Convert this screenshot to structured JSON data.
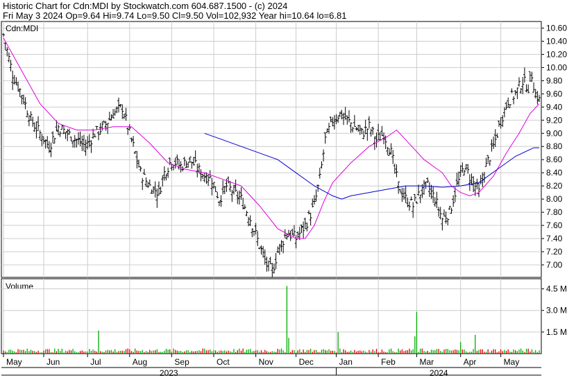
{
  "header": {
    "line1": "Historic Chart for Cdn:MDI by Stockwatch.com 604.687.1500 - (c) 2024",
    "line2": "Fri May  3 2024  Op=9.64  Hi=9.74  Lo=9.50  Cl=9.50  Vol=102,932  Year hi=10.64  lo=6.81"
  },
  "colors": {
    "bar": "#000000",
    "ma_short": "#dd00dd",
    "ma_long": "#0000cc",
    "vol_up": "#00aa00",
    "vol_down": "#dd0000",
    "grid": "#cccccc"
  },
  "chart_data": [
    {
      "type": "bar",
      "subtype": "ohlc",
      "title": "Cdn:MDI",
      "ylim": [
        6.81,
        10.7
      ],
      "yticks": [
        "10.60",
        "10.40",
        "10.20",
        "10.00",
        "9.80",
        "9.60",
        "9.40",
        "9.20",
        "9.00",
        "8.80",
        "8.60",
        "8.40",
        "8.20",
        "8.00",
        "7.80",
        "7.60",
        "7.40",
        "7.20",
        "7.00"
      ],
      "grid": true,
      "x_months": [
        "May",
        "Jun",
        "Jul",
        "Aug",
        "Sep",
        "Oct",
        "Nov",
        "Dec",
        "Jan",
        "Feb",
        "Mar",
        "Apr",
        "May"
      ],
      "x_years": [
        "2023",
        "2024"
      ],
      "close_series": [
        {
          "i": 0,
          "c": 10.5
        },
        {
          "i": 5,
          "c": 9.9
        },
        {
          "i": 10,
          "c": 9.6
        },
        {
          "i": 15,
          "c": 9.2
        },
        {
          "i": 20,
          "c": 9.0
        },
        {
          "i": 25,
          "c": 8.8
        },
        {
          "i": 30,
          "c": 9.1
        },
        {
          "i": 35,
          "c": 9.0
        },
        {
          "i": 40,
          "c": 8.9
        },
        {
          "i": 45,
          "c": 8.8
        },
        {
          "i": 50,
          "c": 9.0
        },
        {
          "i": 55,
          "c": 9.1
        },
        {
          "i": 60,
          "c": 9.3
        },
        {
          "i": 65,
          "c": 9.4
        },
        {
          "i": 70,
          "c": 8.9
        },
        {
          "i": 75,
          "c": 8.4
        },
        {
          "i": 80,
          "c": 8.2
        },
        {
          "i": 85,
          "c": 8.1
        },
        {
          "i": 88,
          "c": 8.4
        },
        {
          "i": 92,
          "c": 8.6
        },
        {
          "i": 97,
          "c": 8.5
        },
        {
          "i": 102,
          "c": 8.6
        },
        {
          "i": 108,
          "c": 8.4
        },
        {
          "i": 114,
          "c": 8.3
        },
        {
          "i": 118,
          "c": 8.0
        },
        {
          "i": 122,
          "c": 8.2
        },
        {
          "i": 126,
          "c": 8.1
        },
        {
          "i": 130,
          "c": 8.0
        },
        {
          "i": 135,
          "c": 7.7
        },
        {
          "i": 140,
          "c": 7.3
        },
        {
          "i": 144,
          "c": 7.0
        },
        {
          "i": 147,
          "c": 6.9
        },
        {
          "i": 150,
          "c": 7.2
        },
        {
          "i": 155,
          "c": 7.5
        },
        {
          "i": 160,
          "c": 7.4
        },
        {
          "i": 165,
          "c": 7.6
        },
        {
          "i": 170,
          "c": 7.9
        },
        {
          "i": 173,
          "c": 8.3
        },
        {
          "i": 176,
          "c": 8.9
        },
        {
          "i": 180,
          "c": 9.2
        },
        {
          "i": 184,
          "c": 9.3
        },
        {
          "i": 188,
          "c": 9.2
        },
        {
          "i": 192,
          "c": 9.1
        },
        {
          "i": 196,
          "c": 9.0
        },
        {
          "i": 200,
          "c": 9.1
        },
        {
          "i": 204,
          "c": 8.9
        },
        {
          "i": 208,
          "c": 9.0
        },
        {
          "i": 212,
          "c": 8.7
        },
        {
          "i": 216,
          "c": 8.2
        },
        {
          "i": 220,
          "c": 8.0
        },
        {
          "i": 224,
          "c": 7.9
        },
        {
          "i": 228,
          "c": 8.1
        },
        {
          "i": 232,
          "c": 8.2
        },
        {
          "i": 236,
          "c": 8.0
        },
        {
          "i": 240,
          "c": 7.7
        },
        {
          "i": 244,
          "c": 7.8
        },
        {
          "i": 248,
          "c": 8.2
        },
        {
          "i": 252,
          "c": 8.5
        },
        {
          "i": 256,
          "c": 8.3
        },
        {
          "i": 260,
          "c": 8.1
        },
        {
          "i": 264,
          "c": 8.5
        },
        {
          "i": 268,
          "c": 8.8
        },
        {
          "i": 272,
          "c": 9.2
        },
        {
          "i": 276,
          "c": 9.5
        },
        {
          "i": 280,
          "c": 9.6
        },
        {
          "i": 284,
          "c": 9.8
        },
        {
          "i": 287,
          "c": 9.7
        },
        {
          "i": 289,
          "c": 9.9
        },
        {
          "i": 291,
          "c": 9.6
        },
        {
          "i": 293,
          "c": 9.5
        }
      ],
      "ma_short": [
        {
          "i": 0,
          "v": 10.45
        },
        {
          "i": 10,
          "v": 9.95
        },
        {
          "i": 20,
          "v": 9.45
        },
        {
          "i": 30,
          "v": 9.15
        },
        {
          "i": 40,
          "v": 9.05
        },
        {
          "i": 50,
          "v": 9.05
        },
        {
          "i": 60,
          "v": 9.1
        },
        {
          "i": 70,
          "v": 9.1
        },
        {
          "i": 80,
          "v": 8.85
        },
        {
          "i": 90,
          "v": 8.55
        },
        {
          "i": 100,
          "v": 8.45
        },
        {
          "i": 110,
          "v": 8.4
        },
        {
          "i": 120,
          "v": 8.3
        },
        {
          "i": 130,
          "v": 8.2
        },
        {
          "i": 140,
          "v": 7.9
        },
        {
          "i": 150,
          "v": 7.55
        },
        {
          "i": 160,
          "v": 7.4
        },
        {
          "i": 165,
          "v": 7.4
        },
        {
          "i": 170,
          "v": 7.6
        },
        {
          "i": 175,
          "v": 7.95
        },
        {
          "i": 180,
          "v": 8.25
        },
        {
          "i": 190,
          "v": 8.55
        },
        {
          "i": 200,
          "v": 8.8
        },
        {
          "i": 210,
          "v": 8.95
        },
        {
          "i": 215,
          "v": 9.05
        },
        {
          "i": 220,
          "v": 8.9
        },
        {
          "i": 230,
          "v": 8.6
        },
        {
          "i": 240,
          "v": 8.4
        },
        {
          "i": 245,
          "v": 8.2
        },
        {
          "i": 250,
          "v": 8.1
        },
        {
          "i": 255,
          "v": 8.05
        },
        {
          "i": 260,
          "v": 8.1
        },
        {
          "i": 268,
          "v": 8.35
        },
        {
          "i": 275,
          "v": 8.7
        },
        {
          "i": 282,
          "v": 9.0
        },
        {
          "i": 288,
          "v": 9.3
        },
        {
          "i": 293,
          "v": 9.45
        }
      ],
      "ma_long": [
        {
          "i": 110,
          "v": 9.0
        },
        {
          "i": 120,
          "v": 8.9
        },
        {
          "i": 130,
          "v": 8.8
        },
        {
          "i": 140,
          "v": 8.7
        },
        {
          "i": 150,
          "v": 8.6
        },
        {
          "i": 160,
          "v": 8.4
        },
        {
          "i": 170,
          "v": 8.2
        },
        {
          "i": 180,
          "v": 8.05
        },
        {
          "i": 185,
          "v": 8.0
        },
        {
          "i": 190,
          "v": 8.05
        },
        {
          "i": 200,
          "v": 8.1
        },
        {
          "i": 210,
          "v": 8.15
        },
        {
          "i": 220,
          "v": 8.2
        },
        {
          "i": 230,
          "v": 8.2
        },
        {
          "i": 240,
          "v": 8.18
        },
        {
          "i": 250,
          "v": 8.2
        },
        {
          "i": 260,
          "v": 8.25
        },
        {
          "i": 270,
          "v": 8.45
        },
        {
          "i": 280,
          "v": 8.65
        },
        {
          "i": 290,
          "v": 8.78
        },
        {
          "i": 293,
          "v": 8.78
        }
      ]
    },
    {
      "type": "bar",
      "title": "Volume",
      "ylim": [
        0,
        5.2
      ],
      "yticks": [
        "4.5 M",
        "3.0 M",
        "1.5 M"
      ],
      "spikes_millions": [
        {
          "i": 52,
          "v": 1.6
        },
        {
          "i": 155,
          "v": 4.7
        },
        {
          "i": 156,
          "v": 1.1
        },
        {
          "i": 183,
          "v": 1.5
        },
        {
          "i": 226,
          "v": 2.9
        },
        {
          "i": 225,
          "v": 1.2
        },
        {
          "i": 250,
          "v": 0.8
        },
        {
          "i": 258,
          "v": 1.3
        }
      ]
    }
  ]
}
